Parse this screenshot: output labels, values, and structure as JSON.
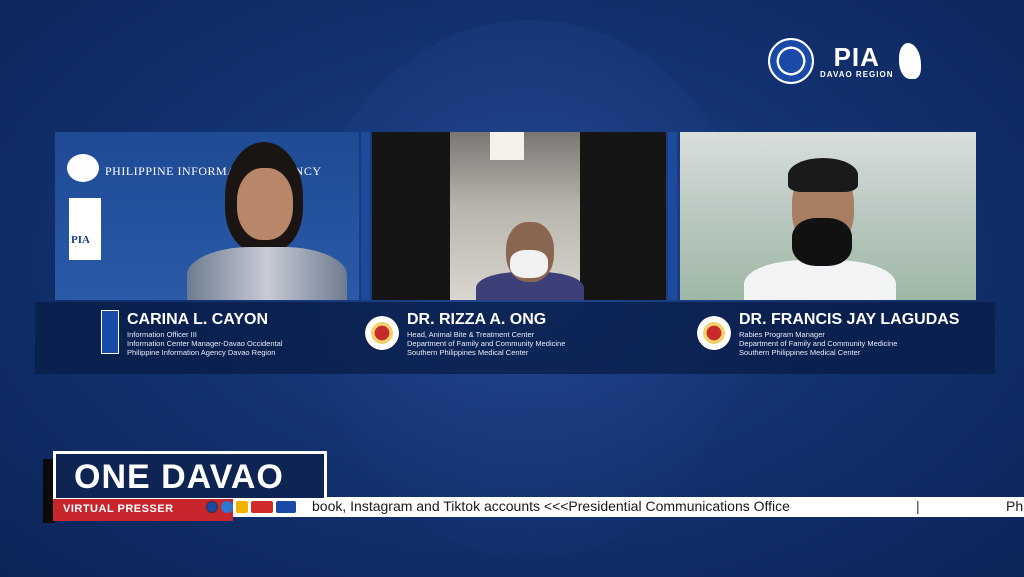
{
  "top_logo": {
    "brand": "PIA",
    "region": "DAVAO REGION"
  },
  "panels": [
    {
      "banner": "PHILIPPINE INFORMATION AGENCY",
      "logo_text": "PIA"
    },
    {},
    {}
  ],
  "speakers": [
    {
      "name": "CARINA L. CAYON",
      "lines": [
        "Information Officer III",
        "Information Center Manager-Davao Occidental",
        "Philippine Information Agency Davao Region"
      ]
    },
    {
      "name": "DR. RIZZA A. ONG",
      "lines": [
        "Head, Animal Bite & Treatment Center",
        "Department of Family and Community Medicine",
        "Southern Philippines Medical Center"
      ]
    },
    {
      "name": "DR. FRANCIS JAY LAGUDAS",
      "lines": [
        "Rabies Program Manager",
        "Department of Family and Community Medicine",
        "Southern Philippines Medical Center"
      ]
    }
  ],
  "brand": {
    "title": "ONE DAVAO",
    "subtitle": "VIRTUAL PRESSER"
  },
  "ticker": {
    "text": "book, Instagram and Tiktok accounts   <<<Presidential Communications Office",
    "separator": "|",
    "tail": "Ph"
  },
  "colors": {
    "background": "#12306e",
    "accent_red": "#c7262d"
  }
}
